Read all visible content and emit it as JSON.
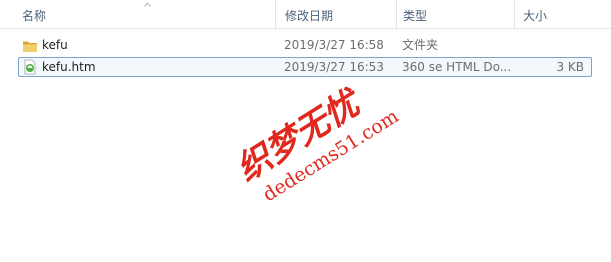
{
  "columns": {
    "name": "名称",
    "modified": "修改日期",
    "type": "类型",
    "size": "大小"
  },
  "files": [
    {
      "name": "kefu",
      "modified": "2019/3/27 16:58",
      "type": "文件夹",
      "size": "",
      "icon": "folder-icon",
      "selected": false
    },
    {
      "name": "kefu.htm",
      "modified": "2019/3/27 16:53",
      "type": "360 se HTML Do...",
      "size": "3 KB",
      "icon": "html-file-icon",
      "selected": true
    }
  ],
  "watermark": {
    "cjk_text": "织梦无忧",
    "url_text": "dedecms51.com",
    "color": "#e0281e"
  },
  "colors": {
    "header_text": "#4c607a",
    "selection_border": "#7da2ce",
    "selection_fill": "#f3f8fd",
    "folder": "#e8c25a"
  }
}
